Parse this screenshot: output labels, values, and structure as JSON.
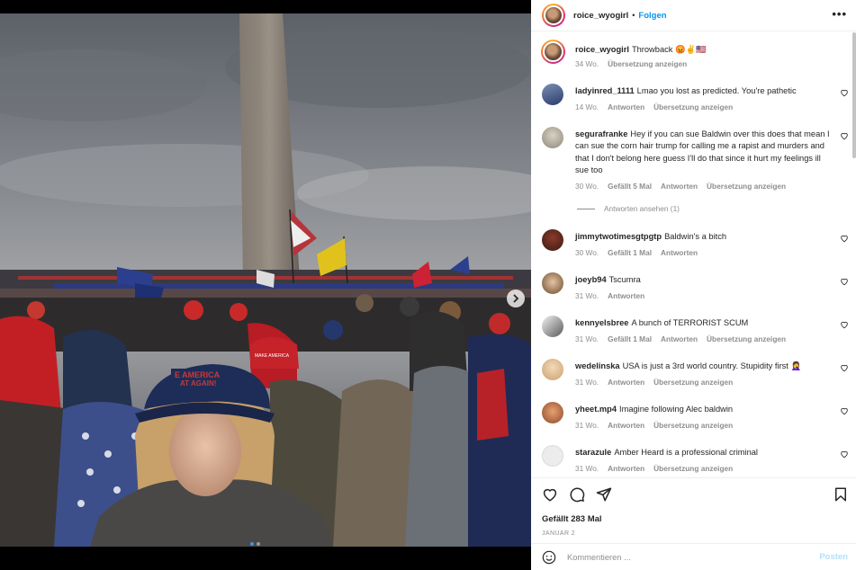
{
  "post": {
    "username": "roice_wyogirl",
    "follow_label": "Folgen",
    "separator": "•",
    "more_label": "•••"
  },
  "caption": {
    "username": "roice_wyogirl",
    "text": "Throwback 😡✌️🇺🇸",
    "time": "34 Wo.",
    "translate": "Übersetzung anzeigen"
  },
  "comments": [
    {
      "username": "ladyinred_1111",
      "text": "Lmao you lost as predicted. You're pathetic",
      "time": "14 Wo.",
      "likes": "",
      "reply": "Antworten",
      "translate": "Übersetzung anzeigen"
    },
    {
      "username": "segurafranke",
      "text": "Hey if you can sue Baldwin over this does that mean I can sue the corn hair trump for calling me a rapist and murders and that I don't belong here guess I'll do that since it hurt my feelings ill sue too",
      "time": "30 Wo.",
      "likes": "Gefällt 5 Mal",
      "reply": "Antworten",
      "translate": "Übersetzung anzeigen"
    },
    {
      "username": "jimmytwotimesgtpgtp",
      "text": "Baldwin's a bitch",
      "time": "30 Wo.",
      "likes": "Gefällt 1 Mal",
      "reply": "Antworten",
      "translate": ""
    },
    {
      "username": "joeyb94",
      "text": "Tscumra",
      "time": "31 Wo.",
      "likes": "",
      "reply": "Antworten",
      "translate": ""
    },
    {
      "username": "kennyelsbree",
      "text": "A bunch of TERRORIST SCUM",
      "time": "31 Wo.",
      "likes": "Gefällt 1 Mal",
      "reply": "Antworten",
      "translate": "Übersetzung anzeigen"
    },
    {
      "username": "wedelinska",
      "text": "USA is just a 3rd world country. Stupidity first 🤦‍♀️",
      "time": "31 Wo.",
      "likes": "",
      "reply": "Antworten",
      "translate": "Übersetzung anzeigen"
    },
    {
      "username": "yheet.mp4",
      "text": "Imagine following Alec baldwin",
      "time": "31 Wo.",
      "likes": "",
      "reply": "Antworten",
      "translate": "Übersetzung anzeigen"
    },
    {
      "username": "starazule",
      "text": "Amber Heard is a professional criminal",
      "time": "31 Wo.",
      "likes": "",
      "reply": "Antworten",
      "translate": "Übersetzung anzeigen"
    }
  ],
  "replies_toggle": "Antworten ansehen (1)",
  "actions": {
    "likes": "Gefällt 283 Mal",
    "date": "JANUAR 2"
  },
  "add_comment": {
    "placeholder": "Kommentieren ...",
    "post_label": "Posten"
  },
  "carousel": {
    "slide_count": 2,
    "active_index": 0
  },
  "colors": {
    "accent": "#0095f6",
    "post_disabled": "#b2dffc",
    "meta": "#8e8e8e",
    "carousel_active": "#3897f0"
  },
  "icons": [
    "chevron-right-icon",
    "heart-icon",
    "comment-icon",
    "share-icon",
    "bookmark-icon",
    "emoji-icon",
    "more-icon"
  ]
}
